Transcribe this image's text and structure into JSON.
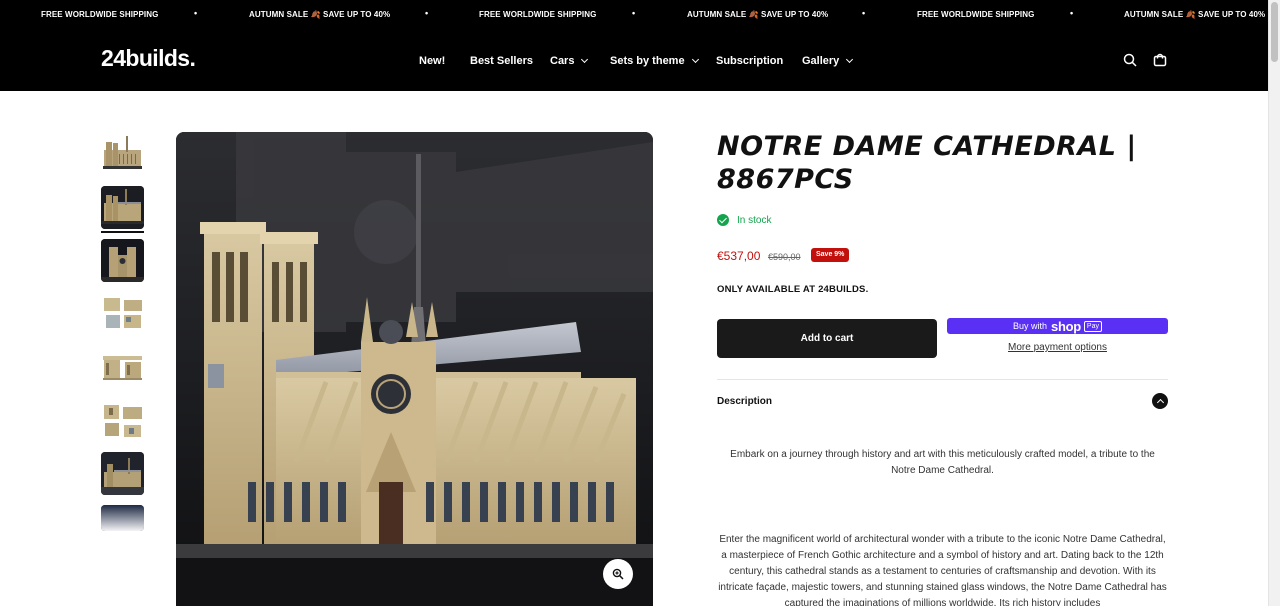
{
  "announcement": {
    "items": [
      "FREE WORLDWIDE SHIPPING",
      "AUTUMN SALE 🍂 SAVE UP TO 40%",
      "FREE WORLDWIDE SHIPPING",
      "AUTUMN SALE 🍂 SAVE UP TO 40%",
      "FREE WORLDWIDE SHIPPING",
      "AUTUMN SALE 🍂 SAVE UP TO 40%"
    ],
    "separator": "•"
  },
  "header": {
    "logo": "24builds.",
    "nav": [
      {
        "label": "New!",
        "has_dropdown": false
      },
      {
        "label": "Best Sellers",
        "has_dropdown": false
      },
      {
        "label": "Cars",
        "has_dropdown": true
      },
      {
        "label": "Sets by theme",
        "has_dropdown": true
      },
      {
        "label": "Subscription",
        "has_dropdown": false
      },
      {
        "label": "Gallery",
        "has_dropdown": true
      }
    ],
    "icons": [
      "search-icon",
      "cart-icon"
    ]
  },
  "gallery": {
    "thumbnails": 8,
    "active_index": 1
  },
  "product": {
    "title": "NOTRE DAME CATHEDRAL | 8867PCS",
    "stock": "In stock",
    "price": "€537,00",
    "compare_price": "€590,00",
    "save_badge": "Save 9%",
    "availability": "ONLY AVAILABLE AT 24BUILDS.",
    "add_to_cart": "Add to cart",
    "shop_pay_prefix": "Buy with",
    "shop_pay_brand": "shop",
    "shop_pay_suffix": "Pay",
    "more_payment": "More payment options",
    "description_label": "Description",
    "description": [
      "Embark on a journey through history and art with this meticulously crafted model, a tribute to the Notre Dame Cathedral.",
      "Enter the magnificent world of architectural wonder with a tribute to the iconic Notre Dame Cathedral, a masterpiece of French Gothic architecture and a symbol of history and art. Dating back to the 12th century, this cathedral stands as a testament to centuries of craftsmanship and devotion. With its intricate façade, majestic towers, and stunning stained glass windows, the Notre Dame Cathedral has captured the imaginations of millions worldwide. Its rich history includes"
    ]
  },
  "colors": {
    "header_bg": "#000000",
    "in_stock": "#14a44d",
    "sale_red": "#c2110d",
    "shop_pay": "#5a31f4",
    "button_dark": "#1a1a1a"
  }
}
